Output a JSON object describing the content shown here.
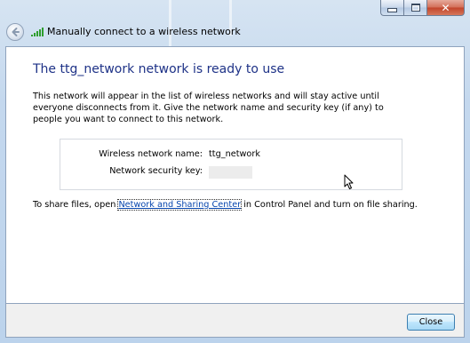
{
  "window": {
    "title": "Manually connect to a wireless network",
    "caption_buttons": {
      "close_glyph": "✕"
    }
  },
  "icons": {
    "back": "back-arrow-icon",
    "signal": "wireless-signal-icon",
    "cursor": "mouse-pointer-icon"
  },
  "main": {
    "heading": "The ttg_network network is ready to use",
    "description": "This network will appear in the list of wireless networks and will stay active until everyone disconnects from it. Give the network name and security key (if any) to people you want to connect to this network.",
    "network_name_label": "Wireless network name:",
    "network_name_value": "ttg_network",
    "security_key_label": "Network security key:",
    "security_key_value": "",
    "share_prefix": "To share files, open ",
    "share_link": "Network and Sharing Center",
    "share_suffix": " in Control Panel and turn on file sharing."
  },
  "footer": {
    "close_label": "Close"
  },
  "colors": {
    "heading": "#1e3287",
    "link": "#0645ad",
    "signal": "#2e9e2e"
  }
}
